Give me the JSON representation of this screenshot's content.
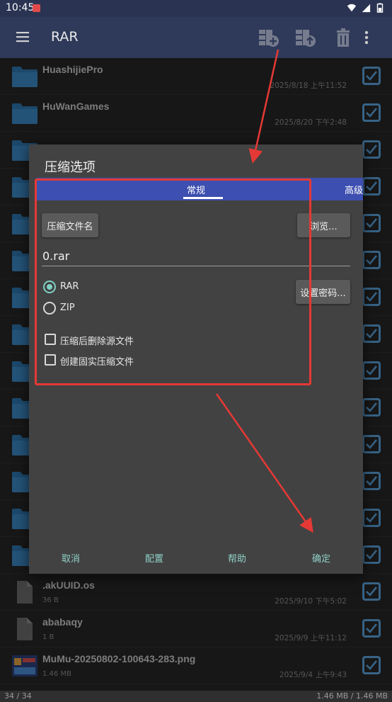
{
  "status_bar": {
    "time": "10:45"
  },
  "app_bar": {
    "title": "RAR"
  },
  "files": [
    {
      "name": "HuashijiePro",
      "size": "",
      "date": "2025/8/18 上午11:52",
      "type": "folder"
    },
    {
      "name": "HuWanGames",
      "size": "",
      "date": "2025/8/20 下午2:48",
      "type": "folder"
    },
    {
      "name": "",
      "size": "",
      "date": "",
      "type": "folder"
    },
    {
      "name": "",
      "size": "",
      "date": "",
      "type": "folder"
    },
    {
      "name": "",
      "size": "",
      "date": "",
      "type": "folder"
    },
    {
      "name": "",
      "size": "",
      "date": "",
      "type": "folder"
    },
    {
      "name": "",
      "size": "",
      "date": "",
      "type": "folder"
    },
    {
      "name": "",
      "size": "",
      "date": "",
      "type": "folder"
    },
    {
      "name": "",
      "size": "",
      "date": "",
      "type": "folder"
    },
    {
      "name": "",
      "size": "",
      "date": "",
      "type": "folder"
    },
    {
      "name": "",
      "size": "",
      "date": "",
      "type": "folder"
    },
    {
      "name": "",
      "size": "",
      "date": "",
      "type": "folder"
    },
    {
      "name": "",
      "size": "",
      "date": "",
      "type": "folder"
    },
    {
      "name": "",
      "size": "",
      "date": "",
      "type": "folder"
    },
    {
      "name": ".akUUID.os",
      "size": "36 B",
      "date": "2025/9/10 下午5:02",
      "type": "file"
    },
    {
      "name": "ababaqy",
      "size": "1 B",
      "date": "2025/9/9 上午11:12",
      "type": "file"
    },
    {
      "name": "MuMu-20250802-100643-283.png",
      "size": "1.46 MB",
      "date": "2025/9/4 上午9:43",
      "type": "image"
    }
  ],
  "footer": {
    "count": "34 / 34",
    "size": "1.46 MB / 1.46 MB"
  },
  "dialog": {
    "title": "压缩选项",
    "tabs": [
      "常规",
      "高级"
    ],
    "archive_name_button": "压缩文件名",
    "browse_button": "浏览...",
    "archive_name_value": "0.rar",
    "format_options": [
      "RAR",
      "ZIP"
    ],
    "selected_format": "RAR",
    "set_password_button": "设置密码...",
    "checkboxes": [
      "压缩后删除源文件",
      "创建固实压缩文件"
    ],
    "actions": {
      "cancel": "取消",
      "profiles": "配置",
      "help": "帮助",
      "ok": "确定"
    }
  },
  "colors": {
    "accent": "#3d4fb0",
    "teal": "#7fd0c4",
    "checkbox_blue": "#5aa0d8",
    "annotation_red": "#e53935"
  }
}
